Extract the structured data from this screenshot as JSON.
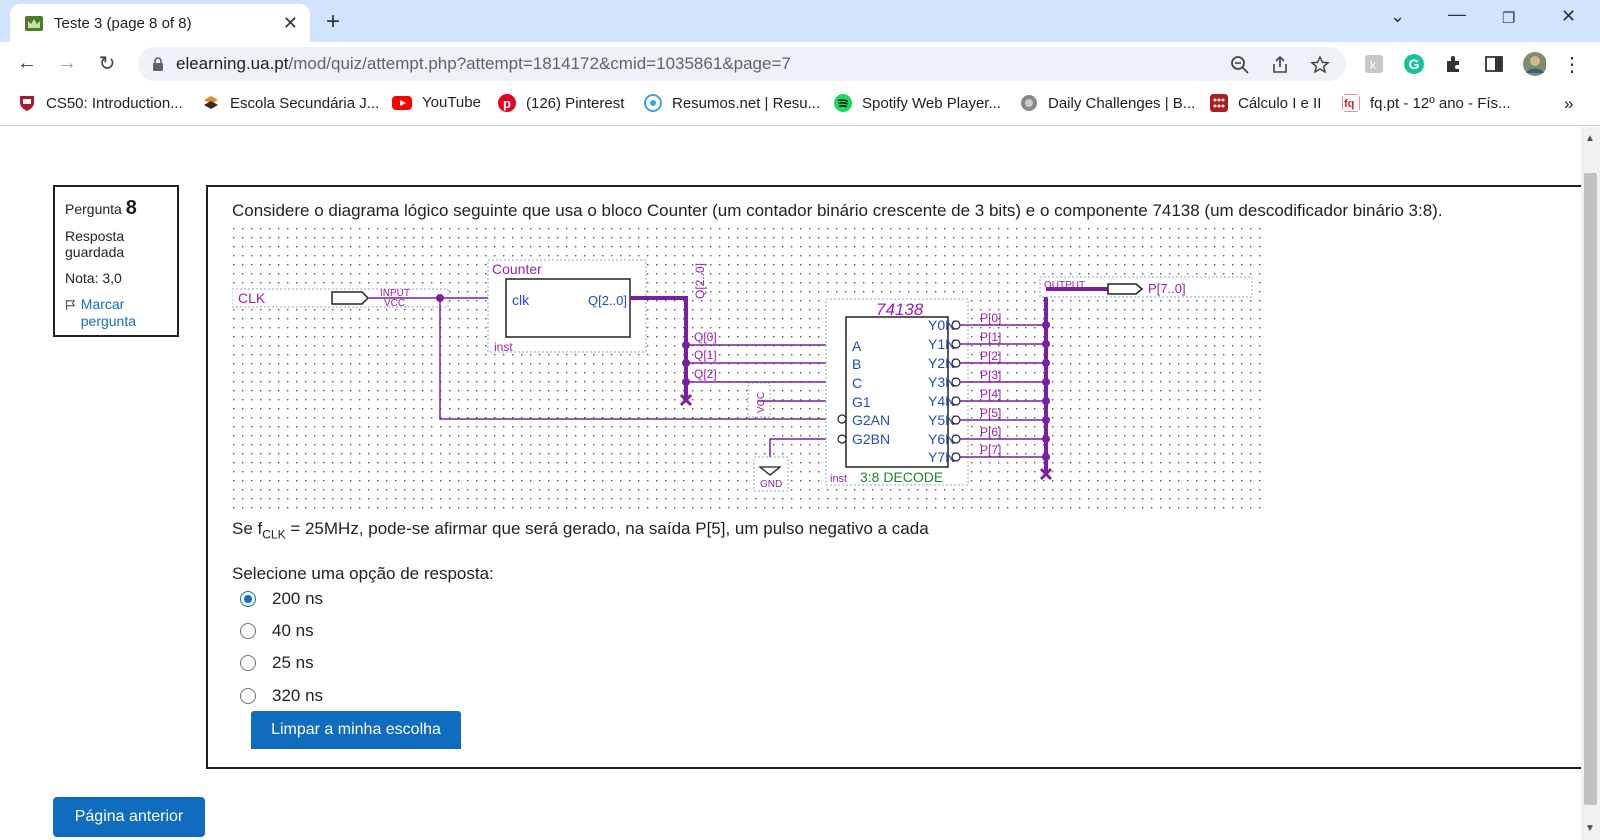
{
  "browser": {
    "tab_title": "Teste 3 (page 8 of 8)",
    "url_host": "elearning.ua.pt",
    "url_path": "/mod/quiz/attempt.php?attempt=1814172&cmid=1035861&page=7",
    "bookmarks": [
      {
        "label": "CS50: Introduction...",
        "icon": "harvard-shield-icon",
        "color": "#a51c30"
      },
      {
        "label": "Escola Secundária J...",
        "icon": "school-logo-icon",
        "color": "#e08a1e"
      },
      {
        "label": "YouTube",
        "icon": "youtube-icon",
        "color": "#ff0000"
      },
      {
        "label": "(126) Pinterest",
        "icon": "pinterest-icon",
        "color": "#e60023"
      },
      {
        "label": "Resumos.net | Resu...",
        "icon": "resumos-icon",
        "color": "#3aa3e3"
      },
      {
        "label": "Spotify Web Player...",
        "icon": "spotify-icon",
        "color": "#1ed760"
      },
      {
        "label": "Daily Challenges | B...",
        "icon": "globe-icon",
        "color": "#777777"
      },
      {
        "label": "Cálculo I e II",
        "icon": "calc-icon",
        "color": "#b01c1c"
      },
      {
        "label": "fq.pt - 12º ano - Fís...",
        "icon": "fq-icon",
        "color": "#d61f26"
      }
    ],
    "more_bookmarks": "»"
  },
  "quiz": {
    "question_label": "Pergunta",
    "question_number": "8",
    "state": "Resposta guardada",
    "grade": "Nota: 3,0",
    "flag_label": "Marcar pergunta",
    "intro": "Considere o diagrama lógico seguinte que usa o bloco Counter (um contador binário crescente de 3 bits) e o componente 74138 (um descodificador binário 3:8).",
    "sub_prefix": "Se f",
    "sub_index": "CLK",
    "sub_suffix": " = 25MHz, pode-se afirmar que será gerado, na saída P[5], um pulso negativo a cada",
    "prompt": "Selecione uma opção de resposta:",
    "options": [
      "200 ns",
      "40 ns",
      "25 ns",
      "320 ns"
    ],
    "selected_index": 0,
    "clear_label": "Limpar a minha escolha",
    "prev_label": "Página anterior"
  },
  "diagram": {
    "clk": "CLK",
    "input": "INPUT",
    "vcc": "VCC",
    "counter_title": "Counter",
    "counter_clk": "clk",
    "counter_q": "Q[2..0]",
    "inst": "inst",
    "bus_q": "Q[2..0]",
    "q_taps": [
      "Q[0]",
      "Q[1]",
      "Q[2]"
    ],
    "dec_title": "74138",
    "dec_inputs": [
      "A",
      "B",
      "C",
      "G1",
      "G2AN",
      "G2BN"
    ],
    "dec_outputs": [
      "Y0N",
      "Y1N",
      "Y2N",
      "Y3N",
      "Y4N",
      "Y5N",
      "Y6N",
      "Y7N"
    ],
    "dec_caption": "3:8 DECODE",
    "gnd": "GND",
    "output": "OUTPUT",
    "p_bus": "P[7..0]",
    "p_taps": [
      "P[0]",
      "P[1]",
      "P[2]",
      "P[3]",
      "P[4]",
      "P[5]",
      "P[6]",
      "P[7]"
    ]
  }
}
